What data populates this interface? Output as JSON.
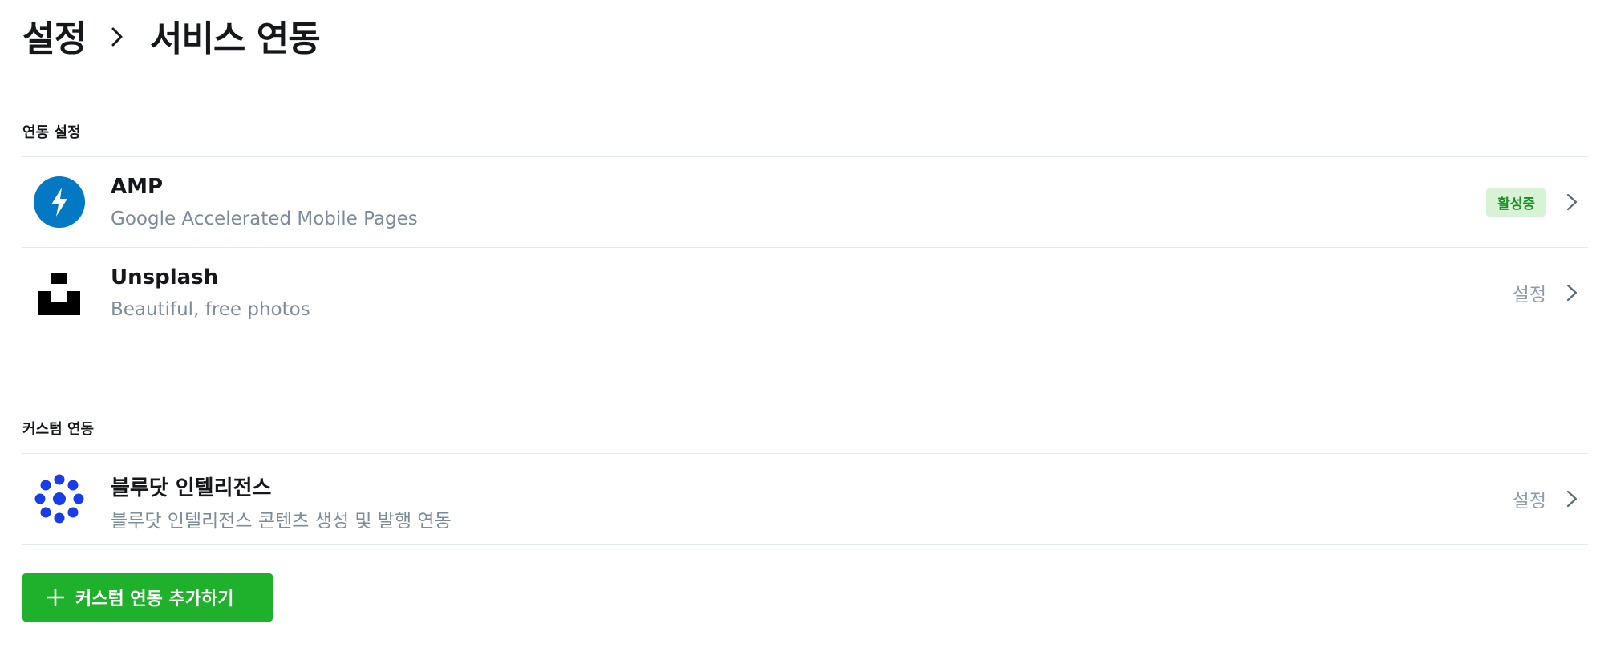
{
  "breadcrumb": {
    "parent": "설정",
    "current": "서비스 연동"
  },
  "sections": {
    "integrations": {
      "label": "연동 설정",
      "items": [
        {
          "title": "AMP",
          "description": "Google Accelerated Mobile Pages",
          "status": "활성중",
          "icon": "amp-icon"
        },
        {
          "title": "Unsplash",
          "description": "Beautiful, free photos",
          "action": "설정",
          "icon": "unsplash-icon"
        }
      ]
    },
    "custom": {
      "label": "커스텀 연동",
      "items": [
        {
          "title": "블루닷 인텔리전스",
          "description": "블루닷 인텔리전스 콘텐츠 생성 및 발행 연동",
          "action": "설정",
          "icon": "bluedot-icon"
        }
      ]
    }
  },
  "add_button": {
    "label": "커스텀 연동 추가하기",
    "icon": "plus-icon"
  },
  "colors": {
    "amp_blue": "#0379c4",
    "bluedot_blue": "#1a3be8",
    "active_badge_bg": "#d8f2d6",
    "active_badge_text": "#1a8f24",
    "primary_button": "#1fb02c",
    "muted_text": "#7c8b9a",
    "divider": "#e6e9eb"
  }
}
